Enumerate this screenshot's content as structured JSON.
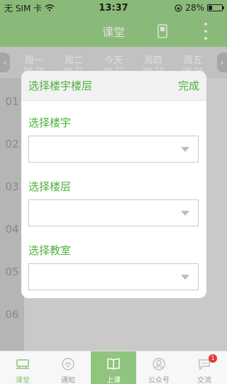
{
  "status_bar": {
    "carrier": "无 SIM 卡",
    "time": "13:37",
    "battery": "28%",
    "battery_level": 0.28
  },
  "header": {
    "title": "课堂"
  },
  "days": [
    {
      "name": "周一",
      "date": "06.20"
    },
    {
      "name": "周二",
      "date": "06.21"
    },
    {
      "name": "今天",
      "date": "06.22"
    },
    {
      "name": "周四",
      "date": "06.23"
    },
    {
      "name": "周五",
      "date": "06.24"
    }
  ],
  "slots": [
    "01",
    "02",
    "03",
    "04",
    "05",
    "06"
  ],
  "dialog": {
    "title": "选择楼宇楼层",
    "done_label": "完成",
    "fields": [
      {
        "label": "选择楼宇",
        "value": ""
      },
      {
        "label": "选择楼层",
        "value": ""
      },
      {
        "label": "选择教室",
        "value": ""
      }
    ]
  },
  "bottom_nav": {
    "items": [
      {
        "label": "课堂",
        "icon": "classroom-icon"
      },
      {
        "label": "通知",
        "icon": "notification-icon"
      },
      {
        "label": "上课",
        "icon": "book-icon"
      },
      {
        "label": "公众号",
        "icon": "public-account-icon"
      },
      {
        "label": "交流",
        "icon": "chat-icon",
        "badge": "1"
      }
    ]
  },
  "colors": {
    "brand_green": "#9ed48a",
    "accent_green": "#4caf3c",
    "badge_red": "#e53935"
  }
}
